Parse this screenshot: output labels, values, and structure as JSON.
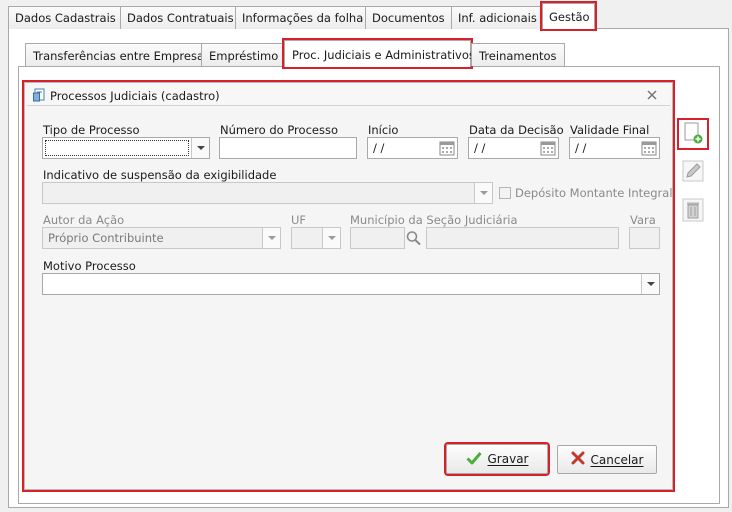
{
  "top_tabs": [
    {
      "label": "Dados Cadastrais"
    },
    {
      "label": "Dados Contratuais"
    },
    {
      "label": "Informações da folha"
    },
    {
      "label": "Documentos"
    },
    {
      "label": "Inf. adicionais"
    },
    {
      "label": "Gestão"
    }
  ],
  "sub_tabs": [
    {
      "label": "Transferências entre Empresas"
    },
    {
      "label": "Empréstimo"
    },
    {
      "label": "Proc. Judiciais e Administrativos"
    },
    {
      "label": "Treinamentos"
    }
  ],
  "dialog": {
    "title": "Processos Judiciais (cadastro)",
    "tipo_processo_label": "Tipo de Processo",
    "tipo_processo_value": "",
    "numero_processo_label": "Número do Processo",
    "numero_processo_value": "",
    "inicio_label": "Início",
    "inicio_value": " /  /",
    "data_decisao_label": "Data da Decisão",
    "data_decisao_value": " /  /",
    "validade_final_label": "Validade Final",
    "validade_final_value": " /  /",
    "indicativo_label": "Indicativo de suspensão da exigibilidade",
    "indicativo_value": "",
    "deposito_label": "Depósito Montante Integral",
    "autor_label": "Autor da Ação",
    "autor_value": "Próprio Contribuinte",
    "uf_label": "UF",
    "uf_value": "",
    "municipio_label": "Município da Seção Judiciária",
    "municipio_value": "",
    "vara_label": "Vara",
    "vara_value": "",
    "motivo_label": "Motivo Processo",
    "motivo_value": "",
    "gravar_label": "Gravar",
    "cancelar_label": "Cancelar"
  },
  "colors": {
    "highlight": "#d6202a",
    "accent_green": "#4caf3a",
    "cancel_red": "#c0392b"
  }
}
